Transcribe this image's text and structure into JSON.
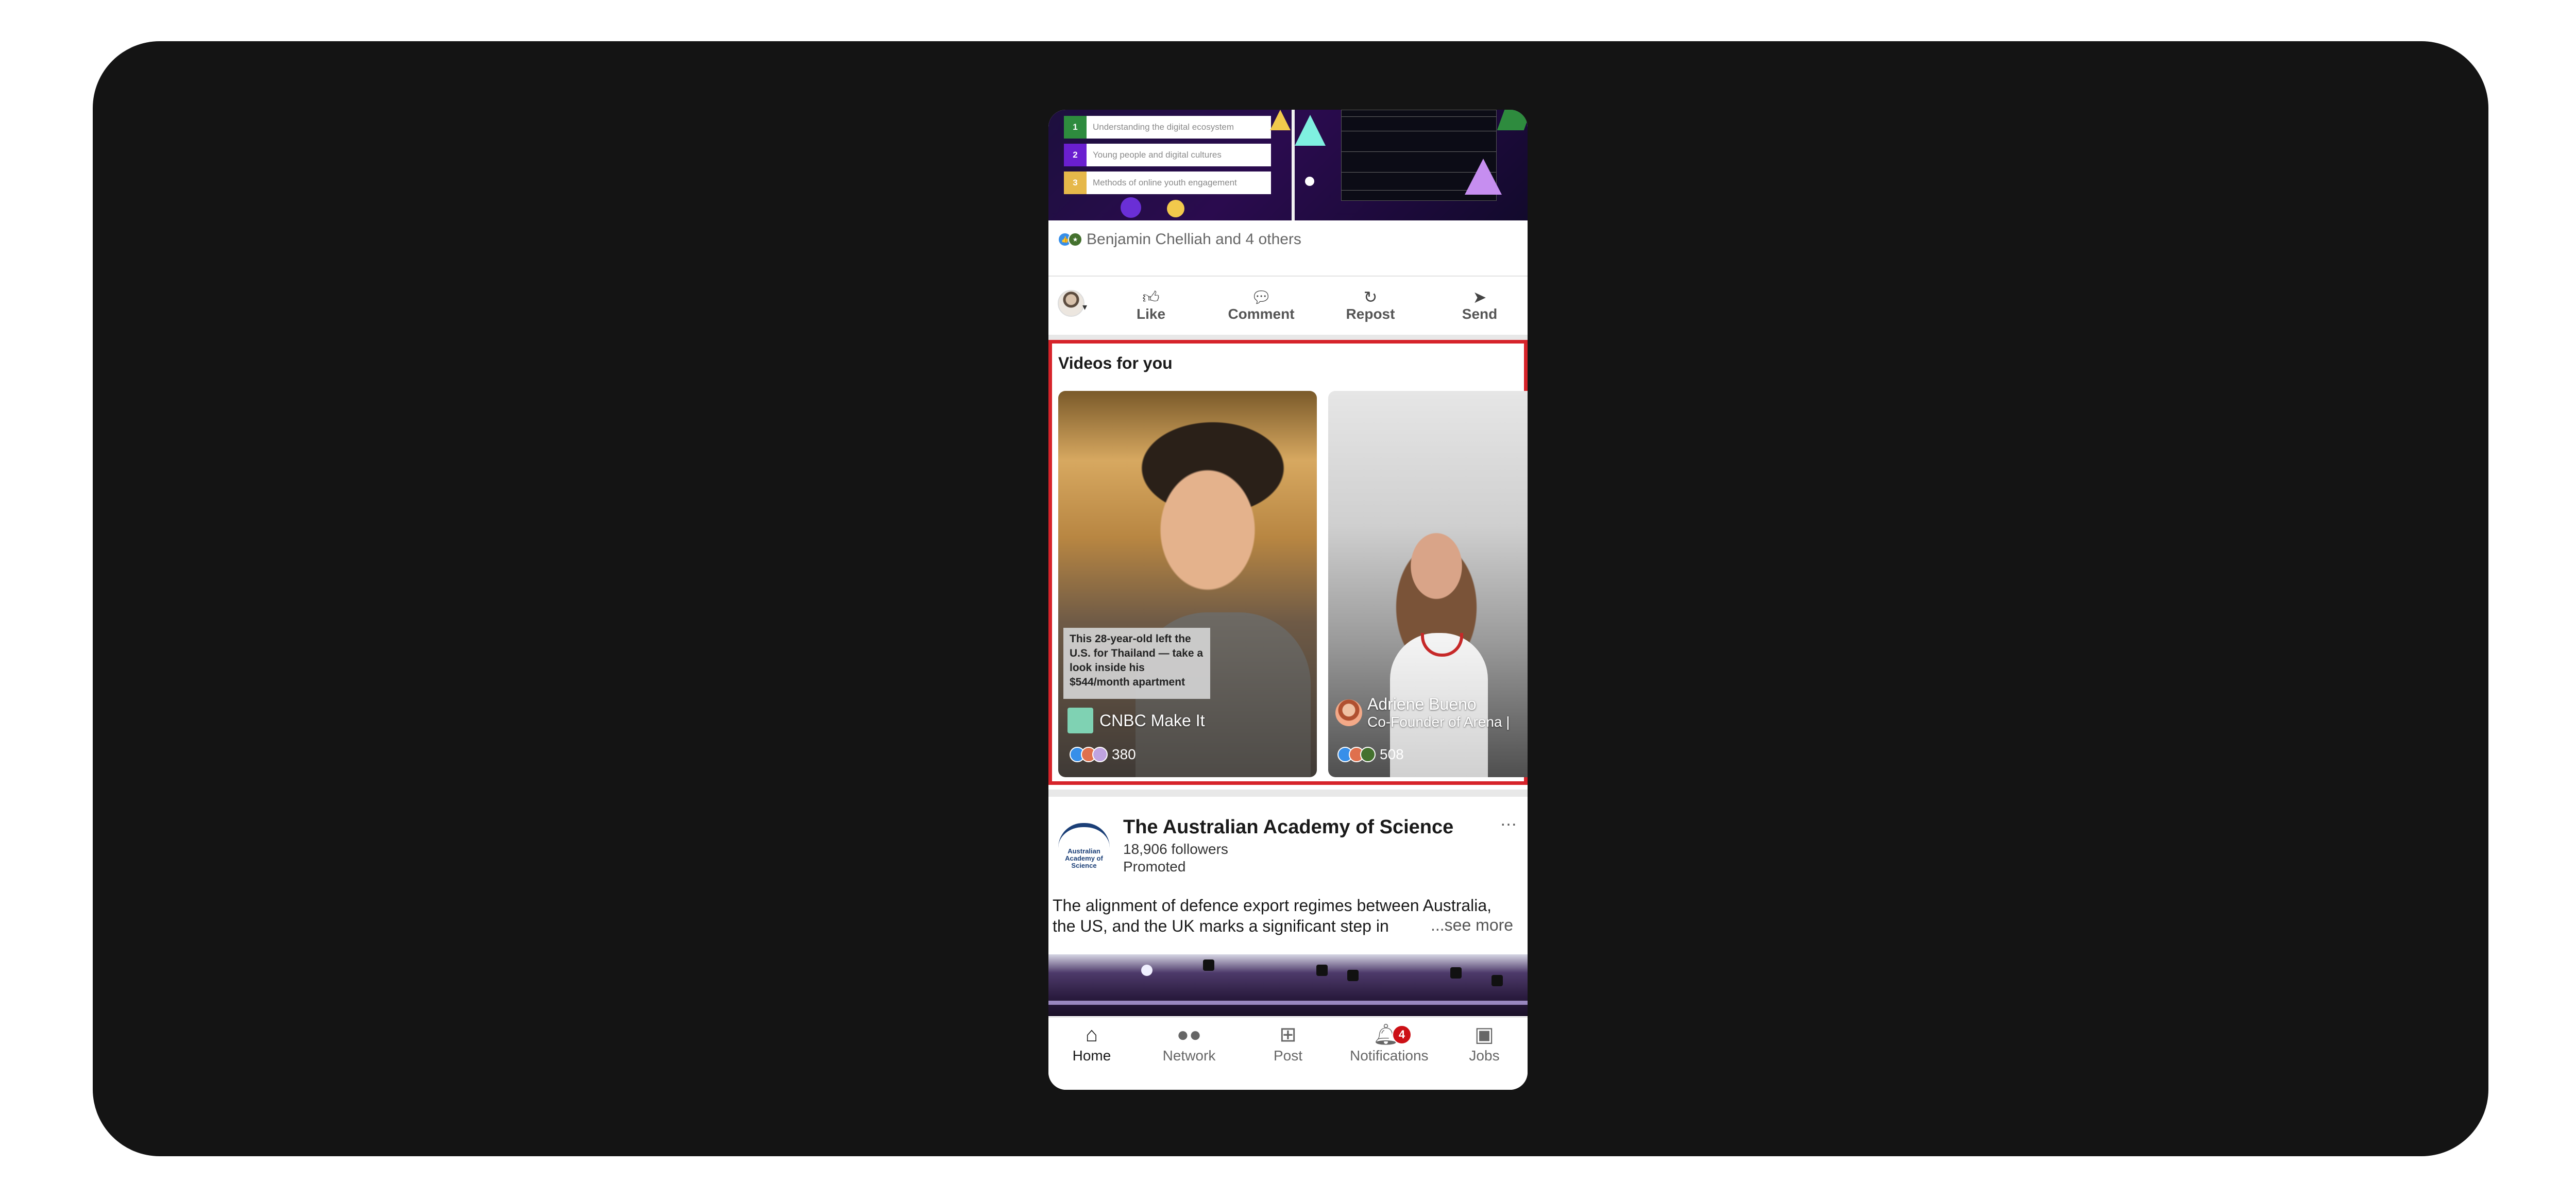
{
  "feed_post": {
    "agenda": [
      {
        "num": "1",
        "text": "Understanding the digital ecosystem",
        "color": "#2e8b3e"
      },
      {
        "num": "2",
        "text": "Young people and digital cultures",
        "color": "#6a1fd0"
      },
      {
        "num": "3",
        "text": "Methods of online youth engagement",
        "color": "#e6b84a"
      }
    ],
    "reactions_text": "Benjamin Chelliah and 4 others",
    "actions": {
      "like": "Like",
      "comment": "Comment",
      "repost": "Repost",
      "send": "Send"
    }
  },
  "videos_module": {
    "title": "Videos for you",
    "cards": [
      {
        "caption": "This 28-year-old left the U.S. for Thailand — take a look inside his $544/month apartment",
        "author": "CNBC Make It",
        "reaction_count": "380"
      },
      {
        "author": "Adriene Bueno",
        "author_subtitle": "Co-Founder of Arena |",
        "reaction_count": "508"
      }
    ]
  },
  "sponsored_post": {
    "org_logo_text": "Australian Academy of Science",
    "org_name": "The Australian Academy of Science",
    "followers": "18,906 followers",
    "promoted": "Promoted",
    "text": "The alignment of defence export regimes between Australia, the US, and the UK marks a significant step in",
    "see_more": "...see more",
    "more_icon": "…"
  },
  "bottom_nav": {
    "items": [
      {
        "label": "Home",
        "icon": "home-icon"
      },
      {
        "label": "Network",
        "icon": "network-icon"
      },
      {
        "label": "Post",
        "icon": "post-icon"
      },
      {
        "label": "Notifications",
        "icon": "bell-icon",
        "badge": "4"
      },
      {
        "label": "Jobs",
        "icon": "briefcase-icon"
      }
    ],
    "active": "Home",
    "accent_badge": "#cc1016"
  },
  "colors": {
    "highlight_border": "#d6232a",
    "frame_bg": "#141414"
  }
}
